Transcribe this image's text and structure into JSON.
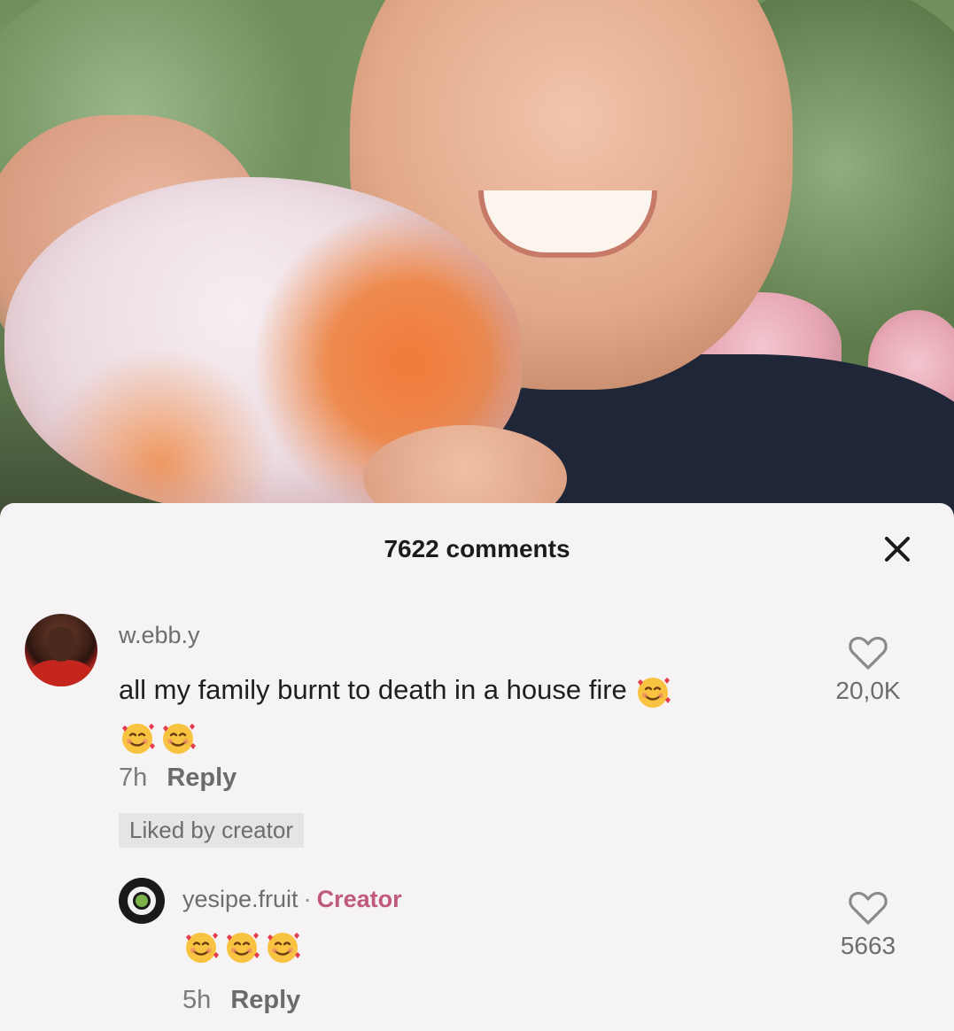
{
  "video": {
    "description_icon": "video-frame"
  },
  "sheet": {
    "comment_count": "7622 comments",
    "close_icon": "close-icon"
  },
  "comments": [
    {
      "username": "w.ebb.y",
      "text": "all my family burnt to death in a house fire",
      "emoji": "smiling-face-with-hearts",
      "time": "7h",
      "reply_label": "Reply",
      "badge": "Liked by creator",
      "likes": "20,0K"
    }
  ],
  "replies": [
    {
      "username": "yesipe.fruit",
      "separator": "·",
      "role": "Creator",
      "emoji": "smiling-face-with-hearts",
      "time": "5h",
      "reply_label": "Reply",
      "likes": "5663"
    }
  ],
  "colors": {
    "creator_accent": "#c05a7a",
    "sheet_bg": "#f5f3f4"
  }
}
